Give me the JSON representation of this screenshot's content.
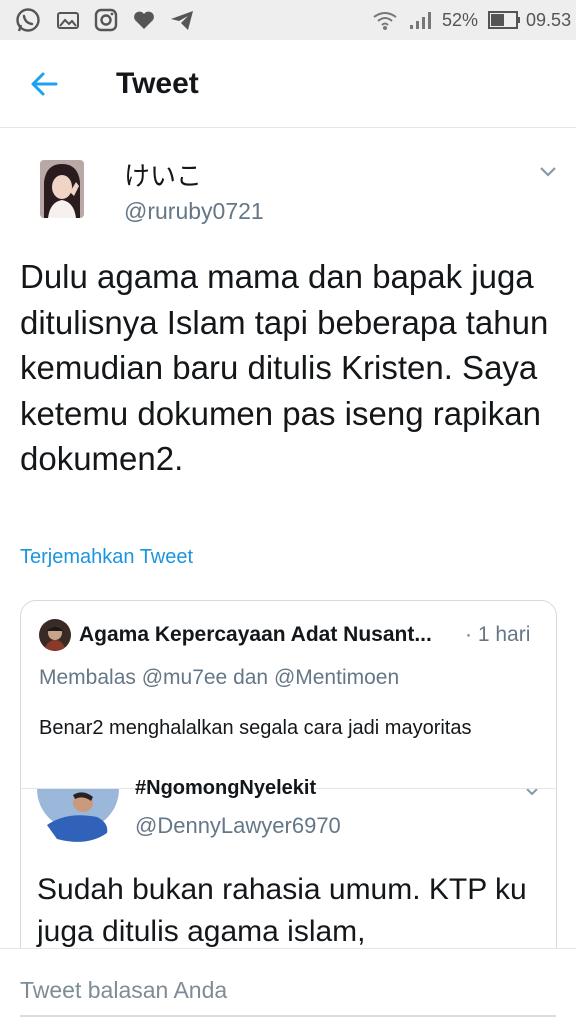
{
  "status_bar": {
    "left_icons": [
      "whatsapp-icon",
      "gallery-icon",
      "instagram-icon",
      "heart-icon",
      "telegram-icon"
    ],
    "battery_percent": "52%",
    "time": "09.53"
  },
  "app_bar": {
    "title": "Tweet"
  },
  "tweet": {
    "display_name": "けいこ",
    "handle": "@ruruby0721",
    "text": "Dulu agama mama dan bapak juga ditulisnya Islam tapi beberapa tahun kemudian baru ditulis Kristen. Saya ketemu dokumen pas iseng rapikan dokumen2.",
    "translate_label": "Terjemahkan Tweet"
  },
  "quote": {
    "name": "Agama Kepercayaan Adat Nusant...",
    "time": "· 1 hari",
    "reply_to": "Membalas @mu7ee dan @Mentimoen",
    "text": "Benar2 menghalalkan segala cara jadi mayoritas",
    "nested": {
      "name_cut": "#NgomongNyelekit",
      "handle": "@DennyLawyer6970",
      "text": "Sudah bukan rahasia umum. KTP ku juga ditulis agama islam,"
    }
  },
  "reply": {
    "placeholder": "Tweet balasan Anda"
  },
  "colors": {
    "accent": "#1da1f2",
    "link": "#1b95e0",
    "secondary_text": "#657786",
    "status_bar_bg": "#eeeeee"
  }
}
